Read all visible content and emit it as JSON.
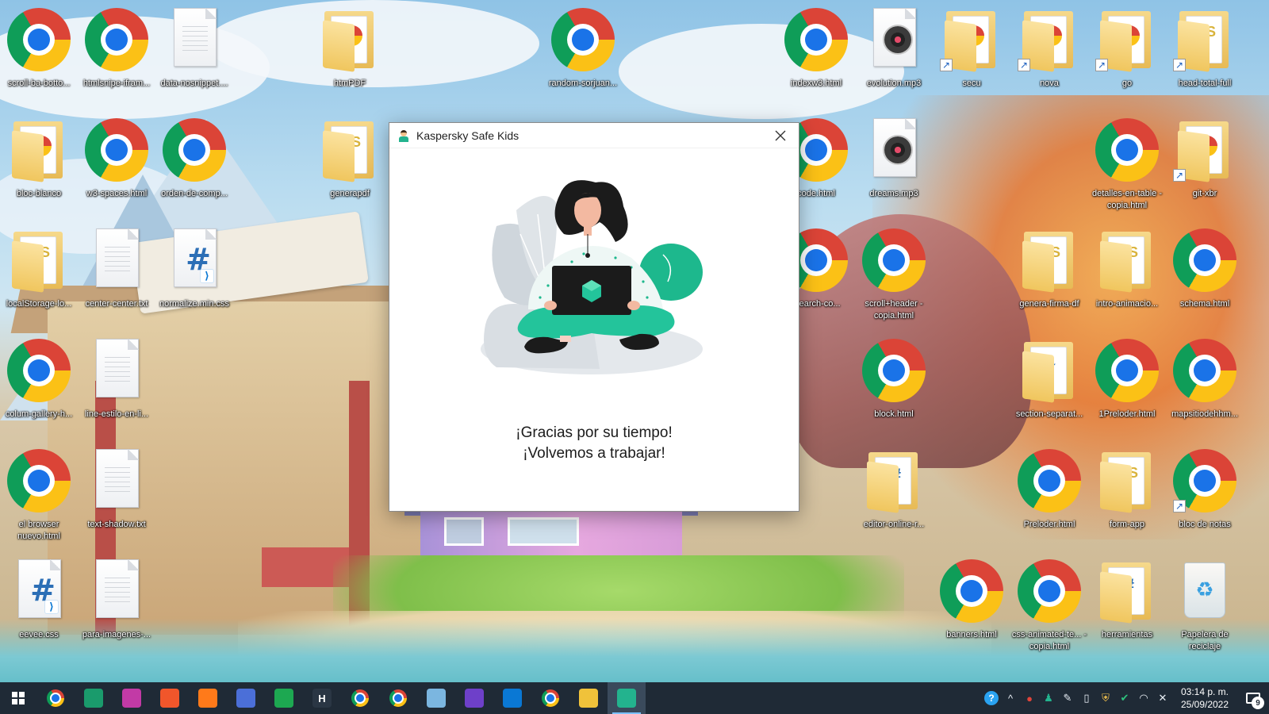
{
  "desktop": {
    "icons": [
      {
        "label": "scroll-ba-botto...",
        "type": "chrome"
      },
      {
        "label": "htmlsnipe-ifram...",
        "type": "chrome"
      },
      {
        "label": "data-nosnippet....",
        "type": "file"
      },
      {
        "label": "htmPDF",
        "type": "folder-chrome"
      },
      {
        "label": "random-sorjuan...",
        "type": "chrome"
      },
      {
        "label": "indexw3.html",
        "type": "chrome"
      },
      {
        "label": "evolution.mp3",
        "type": "mp3"
      },
      {
        "label": "secu",
        "type": "folder-chrome-shortcut"
      },
      {
        "label": "nova",
        "type": "folder-chrome-shortcut"
      },
      {
        "label": "go",
        "type": "folder-chrome-shortcut"
      },
      {
        "label": "head-total-full",
        "type": "folder-js-shortcut"
      },
      {
        "label": "bloc-blanco",
        "type": "folder-chrome"
      },
      {
        "label": "w3-spaces.html",
        "type": "chrome"
      },
      {
        "label": "orden-de-comp...",
        "type": "chrome"
      },
      {
        "label": "generapdf",
        "type": "folder-js"
      },
      {
        "label": "code.html",
        "type": "chrome"
      },
      {
        "label": "dreams.mp3",
        "type": "mp3"
      },
      {
        "label": "detalles-en-table - copia.html",
        "type": "chrome"
      },
      {
        "label": "git-xbr",
        "type": "folder-chrome-shortcut"
      },
      {
        "label": "localStorage-lo...",
        "type": "folder-js"
      },
      {
        "label": "center-center.txt",
        "type": "file"
      },
      {
        "label": "normalize.min.css",
        "type": "css"
      },
      {
        "label": "-search-co...",
        "type": "chrome"
      },
      {
        "label": "scroll+header - copia.html",
        "type": "chrome"
      },
      {
        "label": "genera-firma-df",
        "type": "folder-js"
      },
      {
        "label": "intro-animacio...",
        "type": "folder-js"
      },
      {
        "label": "schema.html",
        "type": "chrome"
      },
      {
        "label": "colum-gallery-h...",
        "type": "chrome"
      },
      {
        "label": "line-estilo-en-li...",
        "type": "file"
      },
      {
        "label": "block.html",
        "type": "chrome"
      },
      {
        "label": "section-separat...",
        "type": "folder-down"
      },
      {
        "label": "1Preloder.html",
        "type": "chrome"
      },
      {
        "label": "mapsitiodehhm...",
        "type": "chrome"
      },
      {
        "label": "el browser nuevo.html",
        "type": "chrome"
      },
      {
        "label": "text-shadow.txt",
        "type": "file"
      },
      {
        "label": "editor-online-r...",
        "type": "folder-css"
      },
      {
        "label": "Preloder.html",
        "type": "chrome"
      },
      {
        "label": "form-app",
        "type": "folder-js"
      },
      {
        "label": "bloc de notas",
        "type": "chrome-shortcut"
      },
      {
        "label": "eevee.css",
        "type": "css"
      },
      {
        "label": "para-imagenes-...",
        "type": "file"
      },
      {
        "label": "banners.html",
        "type": "chrome"
      },
      {
        "label": "css-animated-te... - copia.html",
        "type": "chrome"
      },
      {
        "label": "herramientas",
        "type": "folder-css"
      },
      {
        "label": "Papelera de reciclaje",
        "type": "recycle"
      }
    ]
  },
  "dialog": {
    "title": "Kaspersky Safe Kids",
    "close_icon": "close-icon",
    "message_line1": "¡Gracias por su tiempo!",
    "message_line2": "¡Volvemos a trabajar!",
    "accent_color": "#23c49b"
  },
  "taskbar": {
    "apps": [
      {
        "name": "chrome-multi",
        "color": "#1a73e8"
      },
      {
        "name": "green-app",
        "color": "#1a9b6c"
      },
      {
        "name": "purple-app",
        "color": "#c23aa6"
      },
      {
        "name": "brave",
        "color": "#f1562b"
      },
      {
        "name": "firefox",
        "color": "#ff7a1a"
      },
      {
        "name": "blue-app",
        "color": "#4b6fd8"
      },
      {
        "name": "green-pen",
        "color": "#1da851"
      },
      {
        "name": "h-app",
        "color": "#2a3644",
        "letter": "H"
      },
      {
        "name": "chrome",
        "color": "#1a73e8"
      },
      {
        "name": "chrome-profile",
        "color": "#1a73e8"
      },
      {
        "name": "notepad-app",
        "color": "#7bb6e0"
      },
      {
        "name": "github-desktop",
        "color": "#6e40c9"
      },
      {
        "name": "vscode",
        "color": "#0a78d4"
      },
      {
        "name": "chrome-dev",
        "color": "#1a73e8"
      },
      {
        "name": "file-explorer",
        "color": "#f0c23a"
      },
      {
        "name": "kaspersky-safe-kids",
        "color": "#23b38e"
      }
    ],
    "clock_time": "03:14 p. m.",
    "clock_date": "25/09/2022",
    "notification_count": "9"
  }
}
